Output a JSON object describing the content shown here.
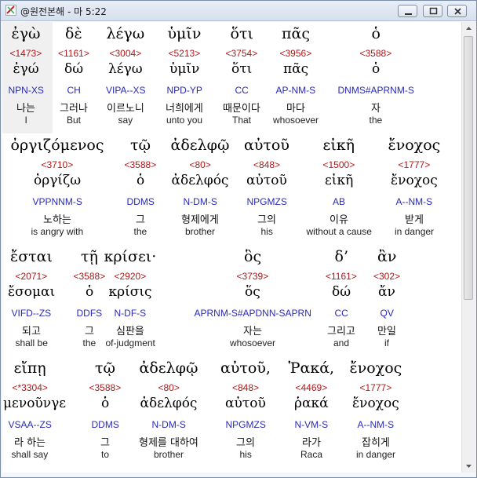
{
  "window": {
    "title": "@원전본해 - 마 5:22"
  },
  "verse": [
    [
      {
        "g": "ἐγὼ",
        "n": "<1473>",
        "l": "ἐγώ",
        "p": "NPN-XS",
        "k": "나는",
        "e": "I"
      },
      {
        "g": "δὲ",
        "n": "<1161>",
        "l": "δώ",
        "p": "CH",
        "k": "그러나",
        "e": "But"
      },
      {
        "g": "λέγω",
        "n": "<3004>",
        "l": "λέγω",
        "p": "VIPA--XS",
        "k": "이르노니",
        "e": "say"
      },
      {
        "g": "ὑμῖν",
        "n": "<5213>",
        "l": "ὑμῖν",
        "p": "NPD-YP",
        "k": "너희에게",
        "e": "unto you"
      },
      {
        "g": "ὅτι",
        "n": "<3754>",
        "l": "ὅτι",
        "p": "CC",
        "k": "때문이다",
        "e": "That"
      },
      {
        "g": "πᾶς",
        "n": "<3956>",
        "l": "πᾶς",
        "p": "AP-NM-S",
        "k": "마다",
        "e": "whosoever"
      },
      {
        "g": "ὁ",
        "n": "<3588>",
        "l": "ὁ",
        "p": "DNMS#APRNM-S",
        "k": "자",
        "e": "the"
      }
    ],
    [
      {
        "g": "ὀργιζόμενος",
        "n": "<3710>",
        "l": "ὀργίζω",
        "p": "VPPNNM-S",
        "k": "노하는",
        "e": "is angry with"
      },
      {
        "g": "τῷ",
        "n": "<3588>",
        "l": "ὁ",
        "p": "DDMS",
        "k": "그",
        "e": "the"
      },
      {
        "g": "ἀδελφῷ",
        "n": "<80>",
        "l": "ἀδελφός",
        "p": "N-DM-S",
        "k": "형제에게",
        "e": "brother"
      },
      {
        "g": "αὐτοῦ",
        "n": "<848>",
        "l": "αὐτοῦ",
        "p": "NPGMZS",
        "k": "그의",
        "e": "his"
      },
      {
        "g": "εἰκῆ",
        "n": "<1500>",
        "l": "εἰκῆ",
        "p": "AB",
        "k": "이유",
        "e": "without a cause"
      },
      {
        "g": "ἔνοχος",
        "n": "<1777>",
        "l": "ἔνοχος",
        "p": "A--NM-S",
        "k": "받게",
        "e": "in danger"
      }
    ],
    [
      {
        "g": "ἔσται",
        "n": "<2071>",
        "l": "ἔσομαι",
        "p": "VIFD--ZS",
        "k": "되고",
        "e": "shall be"
      },
      {
        "g": "τῇ",
        "n": "<3588>",
        "l": "ὁ",
        "p": "DDFS",
        "k": "그",
        "e": "the"
      },
      {
        "g": "κρίσει·",
        "n": "<2920>",
        "l": "κρίσις",
        "p": "N-DF-S",
        "k": "심판을",
        "e": "of-judgment"
      },
      {
        "g": "ὃς",
        "n": "<3739>",
        "l": "ὅς",
        "p": "APRNM-S#APDNN-SAPRN",
        "k": "자는",
        "e": "whosoever"
      },
      {
        "g": "δ’",
        "n": "<1161>",
        "l": "δώ",
        "p": "CC",
        "k": "그리고",
        "e": "and"
      },
      {
        "g": "ἂν",
        "n": "<302>",
        "l": "ἄν",
        "p": "QV",
        "k": "만일",
        "e": "if"
      }
    ],
    [
      {
        "g": "εἴπῃ",
        "n": "<*3304>",
        "l": "μενοῦνγε",
        "p": "VSAA--ZS",
        "k": "라 하는",
        "e": "shall say"
      },
      {
        "g": "τῷ",
        "n": "<3588>",
        "l": "ὁ",
        "p": "DDMS",
        "k": "그",
        "e": "to"
      },
      {
        "g": "ἀδελφῷ",
        "n": "<80>",
        "l": "ἀδελφός",
        "p": "N-DM-S",
        "k": "형제를 대하여",
        "e": "brother"
      },
      {
        "g": "αὐτοῦ,",
        "n": "<848>",
        "l": "αὐτοῦ",
        "p": "NPGMZS",
        "k": "그의",
        "e": "his"
      },
      {
        "g": "Ῥακά,",
        "n": "<4469>",
        "l": "ῥακά",
        "p": "N-VM-S",
        "k": "라가",
        "e": "Raca"
      },
      {
        "g": "ἔνοχος",
        "n": "<1777>",
        "l": "ἔνοχος",
        "p": "A--NM-S",
        "k": "잡히게",
        "e": "in danger"
      }
    ]
  ],
  "colors": {
    "strongs": "#b01818",
    "parsing": "#2a2ab8",
    "selected_column": "#f0f0f0"
  },
  "icons": [
    "app-icon",
    "minimize-icon",
    "maximize-icon",
    "close-icon",
    "scroll-up-arrow-icon",
    "scroll-down-arrow-icon"
  ]
}
